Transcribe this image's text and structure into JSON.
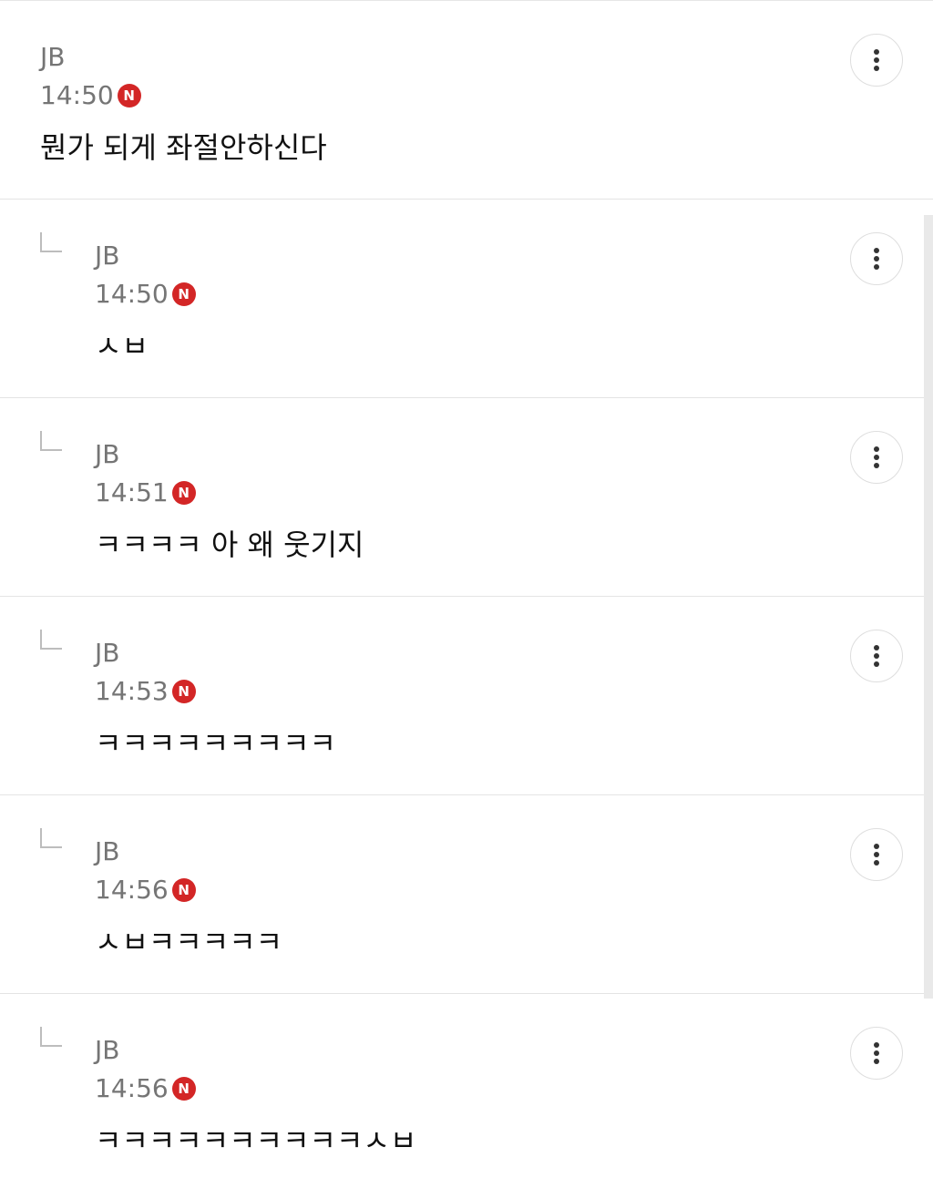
{
  "comments": [
    {
      "author": "JB",
      "time": "14:50",
      "badge": "N",
      "text": "뭔가 되게 좌절안하신다",
      "more_icon": "more-vertical-icon"
    }
  ],
  "replies": [
    {
      "author": "JB",
      "time": "14:50",
      "badge": "N",
      "text": "ㅅㅂ"
    },
    {
      "author": "JB",
      "time": "14:51",
      "badge": "N",
      "text": "ㅋㅋㅋㅋ 아 왜 웃기지"
    },
    {
      "author": "JB",
      "time": "14:53",
      "badge": "N",
      "text": "ㅋㅋㅋㅋㅋㅋㅋㅋㅋ"
    },
    {
      "author": "JB",
      "time": "14:56",
      "badge": "N",
      "text": "ㅅㅂㅋㅋㅋㅋㅋ"
    },
    {
      "author": "JB",
      "time": "14:56",
      "badge": "N",
      "text": "ㅋㅋㅋㅋㅋㅋㅋㅋㅋㅋㅅㅂ"
    }
  ],
  "colors": {
    "badge": "#d32626",
    "meta_text": "#757575",
    "body_text": "#111111",
    "divider": "#e4e4e4"
  }
}
